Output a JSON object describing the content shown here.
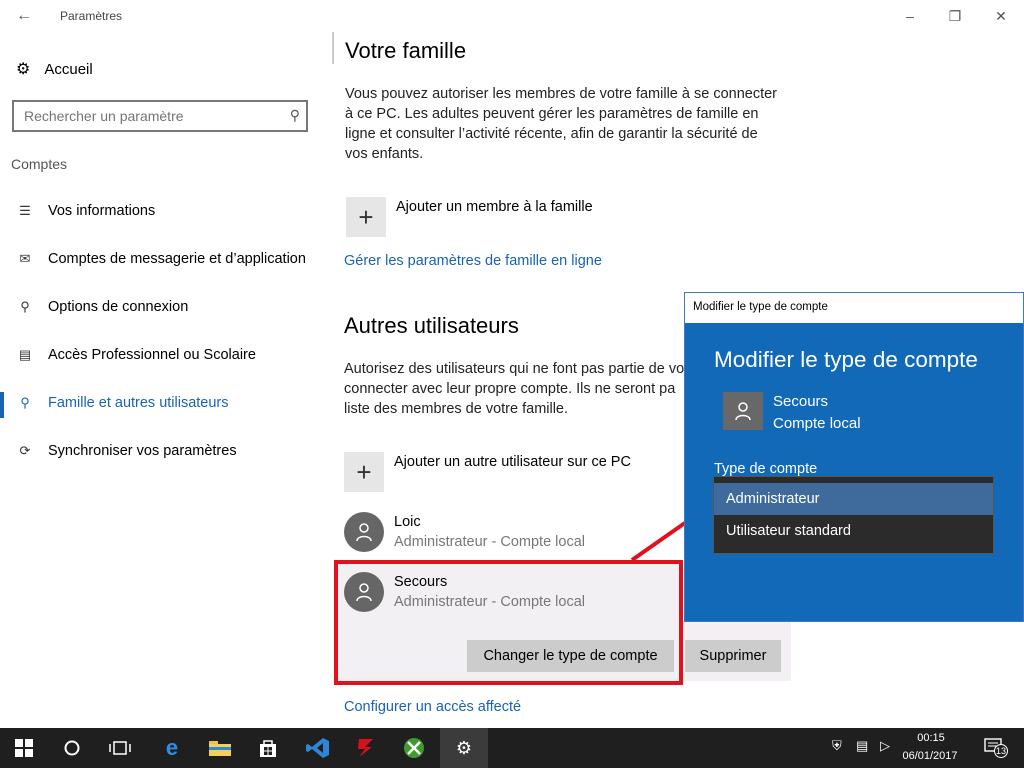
{
  "window": {
    "title": "Paramètres",
    "back_icon": "back-arrow-icon",
    "minimize_icon": "minimize-icon",
    "restore_icon": "restore-icon",
    "close_icon": "close-icon"
  },
  "sidebar": {
    "home_label": "Accueil",
    "search_placeholder": "Rechercher un paramètre",
    "section_title": "Comptes",
    "items": [
      {
        "label": "Vos informations",
        "icon": "person-card-icon"
      },
      {
        "label": "Comptes de messagerie et d’application",
        "icon": "mail-icon"
      },
      {
        "label": "Options de connexion",
        "icon": "key-icon"
      },
      {
        "label": "Accès Professionnel ou Scolaire",
        "icon": "briefcase-icon"
      },
      {
        "label": "Famille et autres utilisateurs",
        "icon": "person-add-icon",
        "active": true
      },
      {
        "label": "Synchroniser vos paramètres",
        "icon": "sync-icon"
      }
    ]
  },
  "main": {
    "family_title": "Votre famille",
    "family_text": [
      "Vous pouvez autoriser les membres de votre famille à se connecter",
      "à ce PC. Les adultes peuvent gérer les paramètres de famille en",
      "ligne et consulter l’activité récente, afin de garantir la sécurité de",
      "vos enfants."
    ],
    "add_family_label": "Ajouter un membre à la famille",
    "manage_family_link": "Gérer les paramètres de famille en ligne",
    "others_title": "Autres utilisateurs",
    "others_text": [
      "Autorisez des utilisateurs qui ne font pas partie de vo",
      "connecter avec leur propre compte. Ils ne seront pa",
      "liste des membres de votre famille."
    ],
    "add_user_label": "Ajouter un autre utilisateur sur ce PC",
    "users": [
      {
        "name": "Loic",
        "role": "Administrateur - Compte local"
      },
      {
        "name": "Secours",
        "role": "Administrateur - Compte local"
      }
    ],
    "change_type_button": "Changer le type de compte",
    "delete_button": "Supprimer",
    "assigned_access_link": "Configurer un accès affecté"
  },
  "dialog": {
    "window_title": "Modifier le type de compte",
    "heading": "Modifier le type de compte",
    "user_name": "Secours",
    "user_type": "Compte local",
    "type_label": "Type de compte",
    "options": [
      "Administrateur",
      "Utilisateur standard"
    ],
    "selected": "Administrateur"
  },
  "taskbar": {
    "time": "00:15",
    "date": "06/01/2017",
    "notification_count": "13",
    "apps": [
      "start-icon",
      "cortana-icon",
      "task-view-icon",
      "edge-icon",
      "file-explorer-icon",
      "store-icon",
      "visual-studio-icon",
      "filezilla-icon",
      "xbox-icon",
      "settings-icon"
    ]
  },
  "colors": {
    "accent": "#1a63b0",
    "dialog_bg": "#1169b8",
    "highlight_red": "#e0121e",
    "taskbar_bg": "#1f1f1f"
  }
}
